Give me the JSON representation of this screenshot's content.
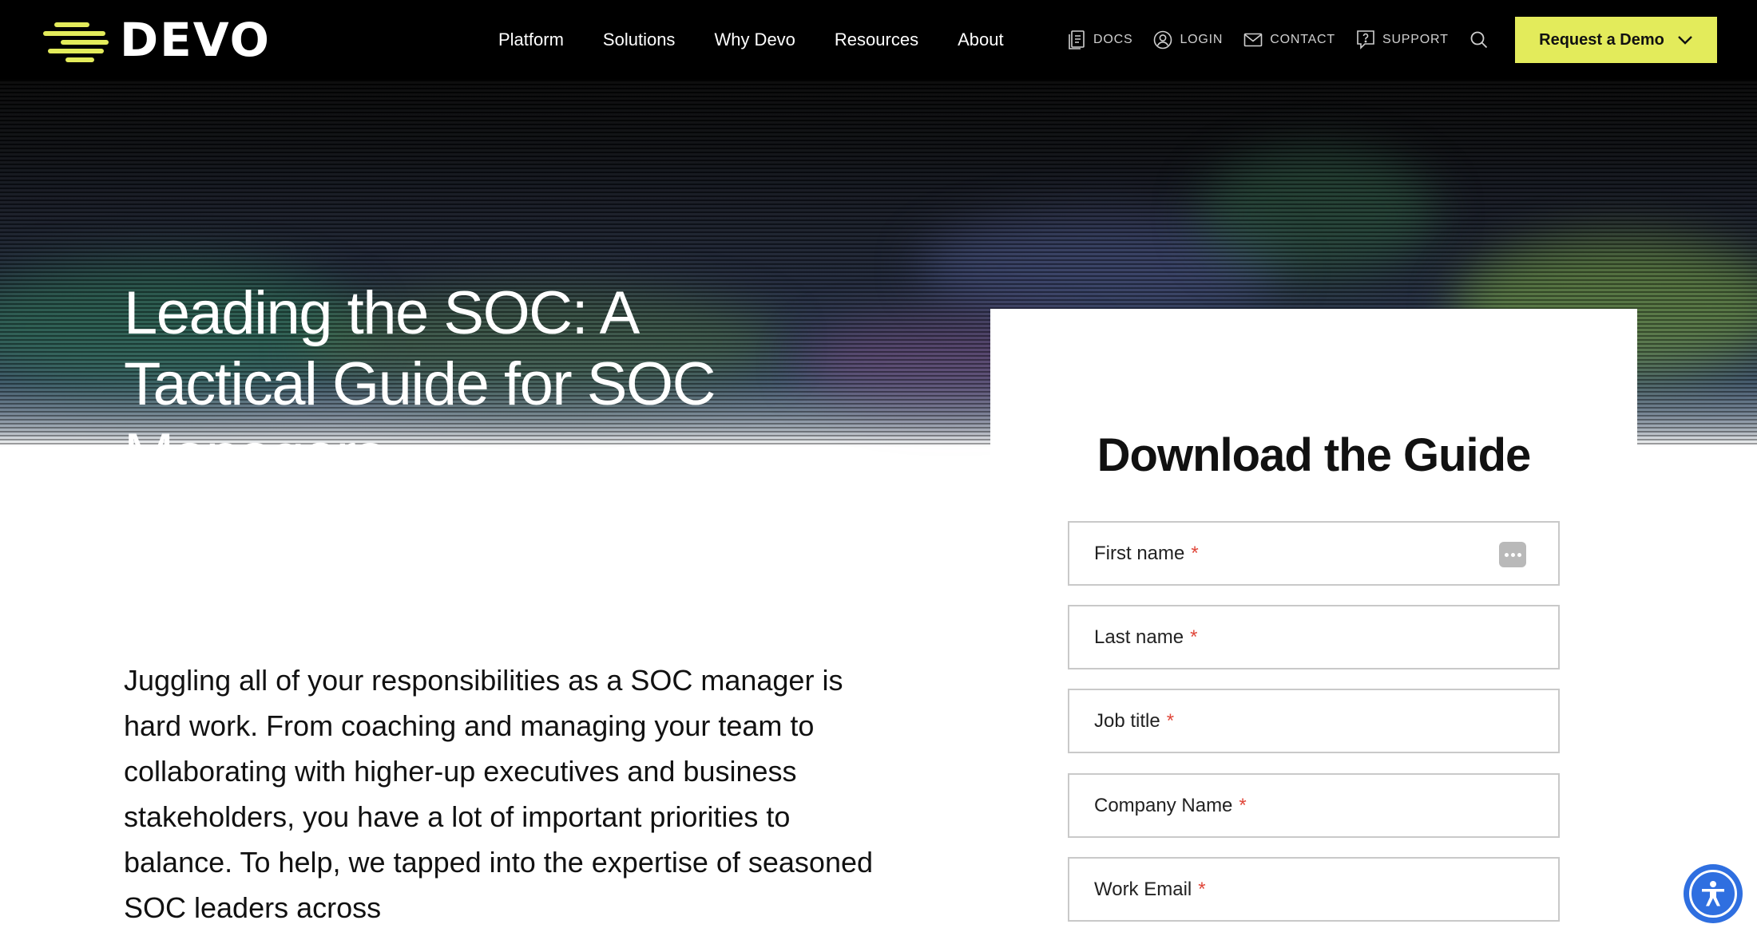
{
  "brand": {
    "name": "DEVO",
    "accent": "#e3eb5b"
  },
  "nav": {
    "items": [
      {
        "label": "Platform"
      },
      {
        "label": "Solutions"
      },
      {
        "label": "Why Devo"
      },
      {
        "label": "Resources"
      },
      {
        "label": "About"
      }
    ],
    "utility": [
      {
        "label": "DOCS",
        "icon": "docs-icon"
      },
      {
        "label": "LOGIN",
        "icon": "user-icon"
      },
      {
        "label": "CONTACT",
        "icon": "mail-icon"
      },
      {
        "label": "SUPPORT",
        "icon": "support-icon"
      }
    ],
    "search_icon": "search-icon",
    "cta_label": "Request a Demo"
  },
  "hero": {
    "title": "Leading the SOC: A Tactical Guide for SOC Managers"
  },
  "intro": {
    "text": "Juggling all of your responsibilities as a SOC manager is hard work. From coaching and managing your team to collaborating with higher-up executives and business stakeholders, you have a lot of important priorities to balance. To help, we tapped into the expertise of seasoned SOC leaders across"
  },
  "form": {
    "title": "Download the Guide",
    "fields": [
      {
        "label": "First name",
        "required": "*"
      },
      {
        "label": "Last name",
        "required": "*"
      },
      {
        "label": "Job title",
        "required": "*"
      },
      {
        "label": "Company Name",
        "required": "*"
      },
      {
        "label": "Work Email",
        "required": "*"
      }
    ]
  },
  "accessibility": {
    "icon": "accessibility-icon",
    "color": "#2f6fe0"
  }
}
